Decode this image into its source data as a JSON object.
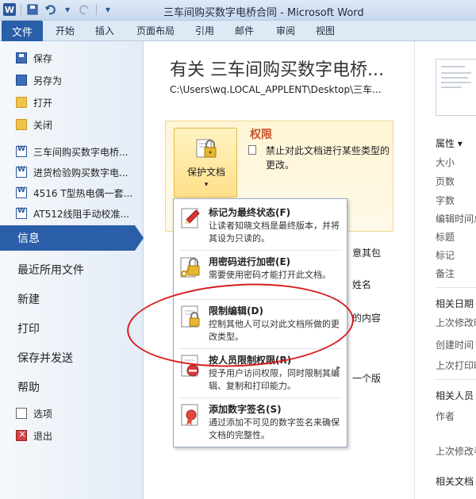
{
  "window": {
    "title": "三车间购买数字电桥合同 - Microsoft Word"
  },
  "ribbon": {
    "tabs": [
      "文件",
      "开始",
      "插入",
      "页面布局",
      "引用",
      "邮件",
      "审阅",
      "视图"
    ]
  },
  "leftnav": {
    "commands": [
      {
        "label": "保存",
        "icon": "save-icon"
      },
      {
        "label": "另存为",
        "icon": "save-as-icon"
      },
      {
        "label": "打开",
        "icon": "folder-open-icon"
      },
      {
        "label": "关闭",
        "icon": "close-folder-icon"
      }
    ],
    "recent_docs": [
      "三车间购买数字电桥...",
      "进货检验购买数字电...",
      "4516 T型热电偶一套...",
      "AT512线阻手动校准..."
    ],
    "info": "信息",
    "sections": [
      "最近所用文件",
      "新建",
      "打印",
      "保存并发送",
      "帮助"
    ],
    "bottom": [
      {
        "label": "选项",
        "icon": "options-icon"
      },
      {
        "label": "退出",
        "icon": "exit-icon"
      }
    ]
  },
  "main": {
    "title": "有关 三车间购买数字电桥...",
    "path": "C:\\Users\\wq.LOCAL_APPLENT\\Desktop\\三车...",
    "permissions": {
      "button_label": "保护文档",
      "caret": "▾",
      "heading": "权限",
      "description": "禁止对此文档进行某些类型的更改。"
    },
    "peek": [
      "意其包",
      "姓名",
      "的内容",
      "一个版"
    ]
  },
  "protect_menu": {
    "items": [
      {
        "title": "标记为最终状态(F)",
        "desc": "让读者知晓文档是最终版本，并将其设为只读的。",
        "icon": "mark-final-icon",
        "arrow": ""
      },
      {
        "title": "用密码进行加密(E)",
        "desc": "需要使用密码才能打开此文档。",
        "icon": "lock-key-icon",
        "arrow": ""
      },
      {
        "title": "限制编辑(D)",
        "desc": "控制其他人可以对此文档所做的更改类型。",
        "icon": "restrict-editing-icon",
        "arrow": ""
      },
      {
        "title": "按人员限制权限(R)",
        "desc": "授予用户访问权限，同时限制其编辑、复制和打印能力。",
        "icon": "restrict-people-icon",
        "arrow": "▸"
      },
      {
        "title": "添加数字签名(S)",
        "desc": "通过添加不可见的数字签名来确保文档的完整性。",
        "icon": "digital-signature-icon",
        "arrow": ""
      }
    ]
  },
  "properties": {
    "header": "属性 ▾",
    "fields": [
      "大小",
      "页数",
      "字数",
      "编辑时间总计",
      "标题",
      "标记",
      "备注"
    ],
    "related_dates_header": "相关日期",
    "dates": [
      "上次修改时间",
      "创建时间",
      "上次打印时间"
    ],
    "related_people_header": "相关人员",
    "people": [
      "作者",
      "上次修改者"
    ],
    "related_docs_header": "相关文档"
  },
  "colors": {
    "accent": "#2a5ea8",
    "permission_heading": "#c5512a",
    "annotation": "#d71e1e"
  }
}
